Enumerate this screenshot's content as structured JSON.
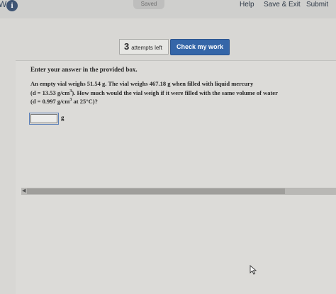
{
  "header": {
    "logo_letter": "W",
    "info_icon_glyph": "i",
    "saved_label": "Saved",
    "links": {
      "help": "Help",
      "save_exit": "Save & Exit",
      "submit": "Submit"
    }
  },
  "toolbar": {
    "attempts_count": "3",
    "attempts_label": "attempts left",
    "check_label": "Check my work"
  },
  "question": {
    "instruction": "Enter your answer in the provided box.",
    "line1": "An empty vial weighs 51.54 g. The vial weighs 467.18 g when filled with liquid mercury",
    "line2_a": "(d = 13.53 g/cm",
    "line2_sup": "3",
    "line2_b": "). How much would the vial weigh if it were filled with the same volume of water",
    "line3_a": "(d = 0.997 g/cm",
    "line3_sup": "3",
    "line3_b": " at 25°C)?",
    "answer_value": "",
    "answer_unit": "g"
  },
  "colors": {
    "accent": "#3566a8",
    "background": "#d8d7d4"
  }
}
